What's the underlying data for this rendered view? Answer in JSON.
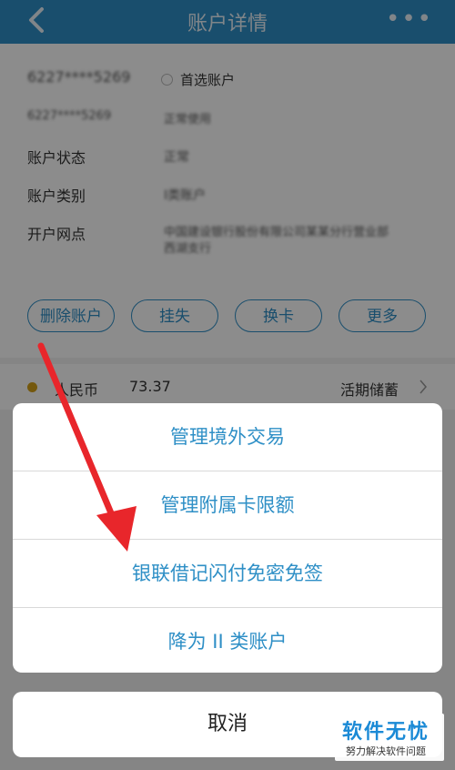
{
  "header": {
    "title": "账户详情",
    "more_label": "•••"
  },
  "account": {
    "card_number": "6227****5269",
    "preferred_label": "首选账户",
    "row2_left": "6227****5269",
    "row2_right": "正常使用",
    "status_label": "账户状态",
    "status_value": "正常",
    "type_label": "账户类别",
    "type_value": "I类账户",
    "branch_label": "开户网点",
    "branch_value_line1": "中国建设银行股份有限公司某某分行营业部",
    "branch_value_line2": "西湖支行"
  },
  "actions": [
    "删除账户",
    "挂失",
    "换卡",
    "更多"
  ],
  "currency": {
    "name": "人民币",
    "amount": "73.37",
    "type": "活期储蓄"
  },
  "sheet": {
    "items": [
      "管理境外交易",
      "管理附属卡限额",
      "银联借记闪付免密免签",
      "降为 II 类账户"
    ],
    "cancel": "取消"
  },
  "watermark": {
    "title": "软件无忧",
    "subtitle": "努力解决软件问题"
  },
  "colors": {
    "header_bg": "#2e8fc6",
    "accent": "#2e8fc6",
    "arrow": "#e8262b"
  }
}
